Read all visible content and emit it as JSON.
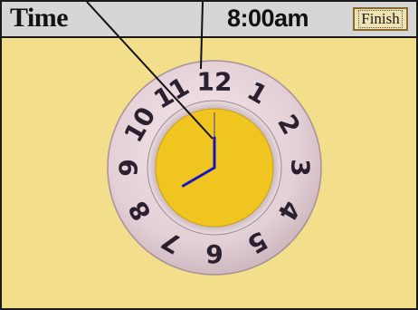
{
  "header": {
    "title": "Time",
    "time_readout": "8:00am",
    "finish_label": "Finish"
  },
  "clock": {
    "hour": 8,
    "minute": 0,
    "numerals": [
      "12",
      "1",
      "2",
      "3",
      "4",
      "5",
      "6",
      "7",
      "8",
      "9",
      "10",
      "11"
    ]
  },
  "colors": {
    "background": "#f3de8c",
    "header": "#d6d6d6",
    "dial_ring": "#e7d6dc",
    "dial_face": "#f0c520",
    "hands": "#1515c8",
    "pointer_lines": "#111111"
  }
}
